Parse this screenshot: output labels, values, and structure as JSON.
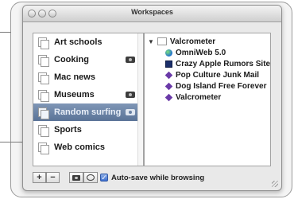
{
  "window": {
    "title": "Workspaces"
  },
  "workspaces": {
    "items": [
      {
        "label": "Art schools",
        "has_snapshot": false,
        "selected": false
      },
      {
        "label": "Cooking",
        "has_snapshot": true,
        "selected": false
      },
      {
        "label": "Mac news",
        "has_snapshot": false,
        "selected": false
      },
      {
        "label": "Museums",
        "has_snapshot": true,
        "selected": false
      },
      {
        "label": "Random surfing",
        "has_snapshot": true,
        "selected": true
      },
      {
        "label": "Sports",
        "has_snapshot": false,
        "selected": false
      },
      {
        "label": "Web comics",
        "has_snapshot": false,
        "selected": false
      }
    ]
  },
  "tree": {
    "root": {
      "label": "Valcrometer",
      "expanded": true
    },
    "children": [
      {
        "label": "OmniWeb 5.0",
        "icon": "globe-icon"
      },
      {
        "label": "Crazy Apple Rumors Site",
        "icon": "crazy-apple-icon"
      },
      {
        "label": "Pop Culture Junk Mail",
        "icon": "gem-icon"
      },
      {
        "label": "Dog Island Free Forever",
        "icon": "gem-icon"
      },
      {
        "label": "Valcrometer",
        "icon": "gem-icon"
      }
    ]
  },
  "toolbar": {
    "add_label": "+",
    "remove_label": "−",
    "autosave_label": "Auto-save while browsing",
    "autosave_checked": true,
    "checkmark": "✓"
  },
  "colors": {
    "selection": "#5a7397",
    "checkbox": "#3d6fcf",
    "globe": "#1d6fd1",
    "gem": "#6a3aa8"
  }
}
